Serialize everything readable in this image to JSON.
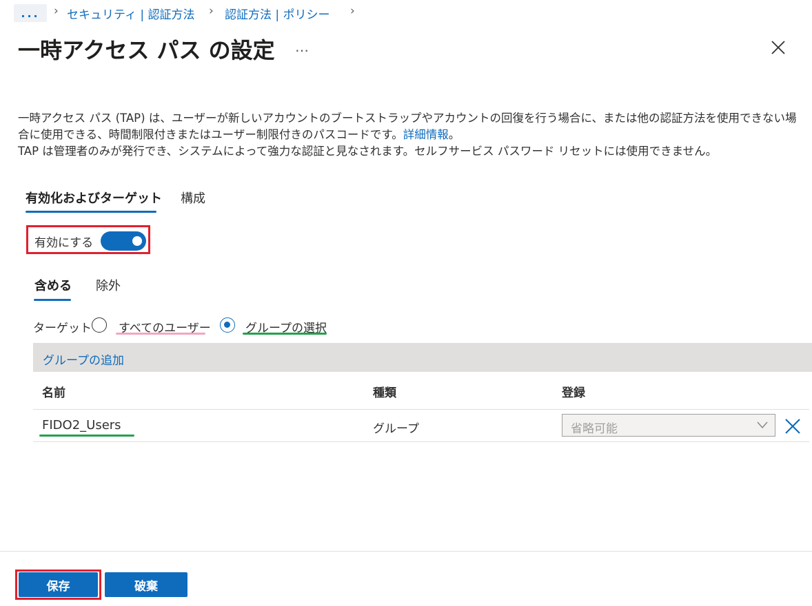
{
  "breadcrumb": {
    "more": "...",
    "items": [
      "セキュリティ | 認証方法",
      "認証方法 | ポリシー"
    ]
  },
  "header": {
    "title": "一時アクセス パス の設定",
    "more": "…"
  },
  "description": {
    "line1": "一時アクセス パス (TAP) は、ユーザーが新しいアカウントのブートストラップやアカウントの回復を行う場合に、または他の認証方法を使用できない場合に使用できる、時間制限付きまたはユーザー制限付きのパスコードです。",
    "link": "詳細情報",
    "line1_end": "。",
    "line2": "TAP は管理者のみが発行でき、システムによって強力な認証と見なされます。セルフサービス パスワード リセットには使用できません。"
  },
  "tabs": [
    {
      "label": "有効化およびターゲット",
      "active": true
    },
    {
      "label": "構成",
      "active": false
    }
  ],
  "enable": {
    "label": "有効にする",
    "on": true
  },
  "subtabs": [
    {
      "label": "含める",
      "active": true
    },
    {
      "label": "除外",
      "active": false
    }
  ],
  "target": {
    "label": "ターゲット",
    "options": [
      {
        "label": "すべてのユーザー",
        "selected": false
      },
      {
        "label": "グループの選択",
        "selected": true
      }
    ]
  },
  "add_group": "グループの追加",
  "table": {
    "columns": [
      "名前",
      "種類",
      "登録"
    ],
    "rows": [
      {
        "name": "FIDO2_Users",
        "type": "グループ",
        "registration": "省略可能"
      }
    ]
  },
  "footer": {
    "save": "保存",
    "discard": "破棄"
  },
  "colors": {
    "accent": "#0f6cbd",
    "highlight_red": "#e0202e",
    "highlight_green": "#22a14a",
    "highlight_pink": "#f3a5c0"
  }
}
